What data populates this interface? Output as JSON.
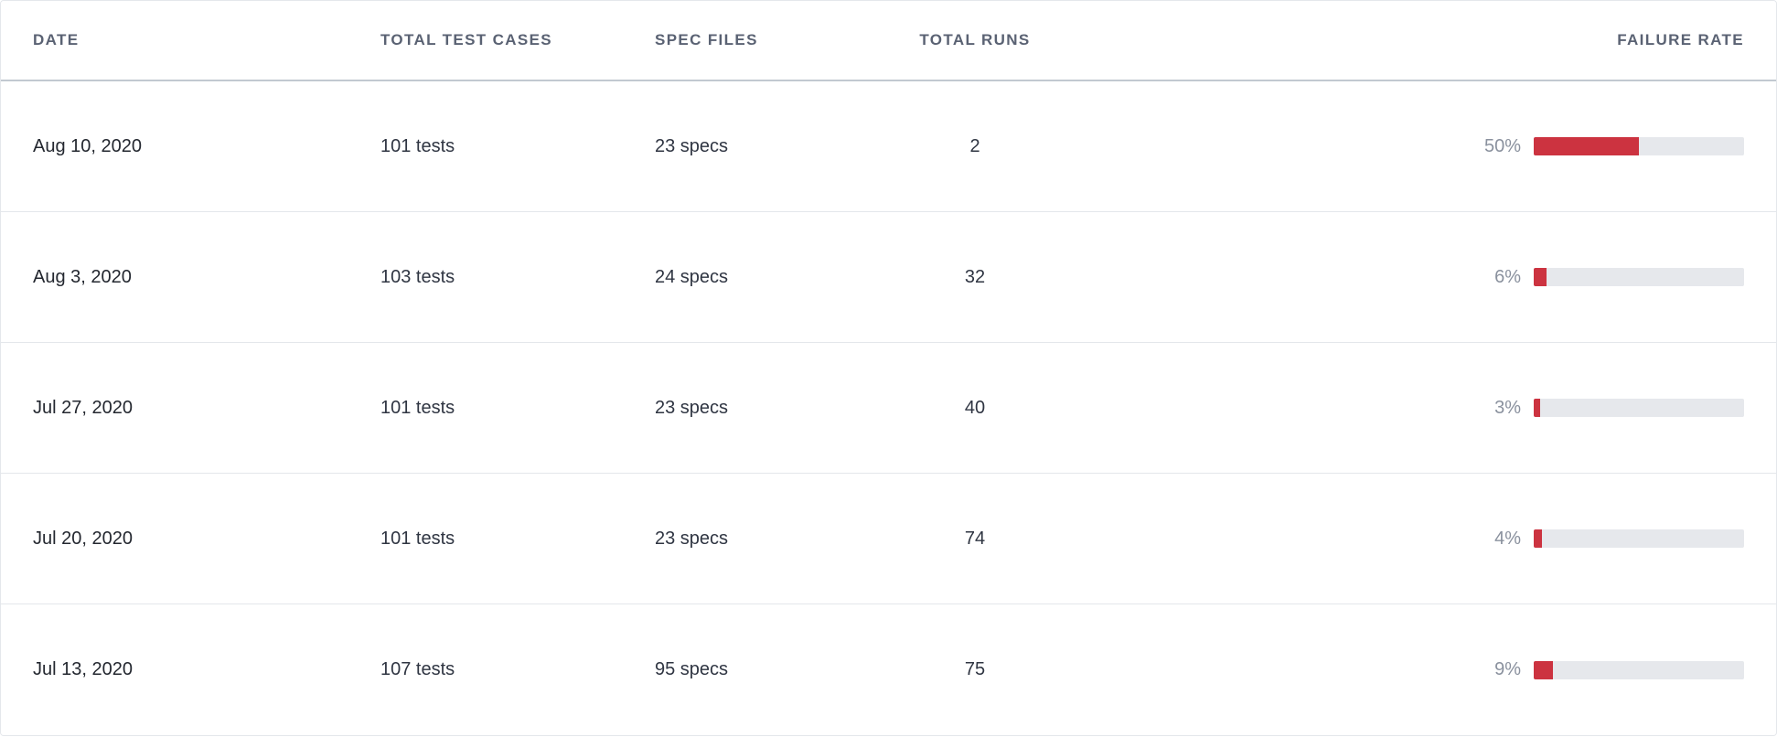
{
  "columns": {
    "date": "Date",
    "tests": "Total Test Cases",
    "specs": "Spec Files",
    "runs": "Total Runs",
    "failure": "Failure Rate"
  },
  "rows": [
    {
      "date": "Aug 10, 2020",
      "tests": "101 tests",
      "specs": "23 specs",
      "runs": "2",
      "failure_pct": "50%",
      "failure_value": 50
    },
    {
      "date": "Aug 3, 2020",
      "tests": "103 tests",
      "specs": "24 specs",
      "runs": "32",
      "failure_pct": "6%",
      "failure_value": 6
    },
    {
      "date": "Jul 27, 2020",
      "tests": "101 tests",
      "specs": "23 specs",
      "runs": "40",
      "failure_pct": "3%",
      "failure_value": 3
    },
    {
      "date": "Jul 20, 2020",
      "tests": "101 tests",
      "specs": "23 specs",
      "runs": "74",
      "failure_pct": "4%",
      "failure_value": 4
    },
    {
      "date": "Jul 13, 2020",
      "tests": "107 tests",
      "specs": "95 specs",
      "runs": "75",
      "failure_pct": "9%",
      "failure_value": 9
    }
  ],
  "colors": {
    "bar_fill": "#cc3340",
    "bar_track": "#e6e8ec"
  }
}
